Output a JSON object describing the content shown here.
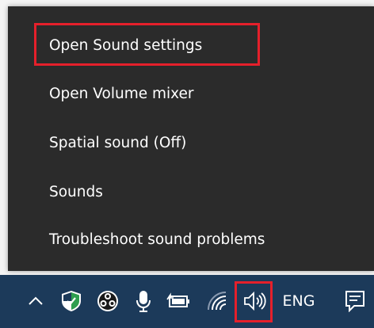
{
  "menu": {
    "items": [
      {
        "label": "Open Sound settings"
      },
      {
        "label": "Open Volume mixer"
      },
      {
        "label": "Spatial sound (Off)"
      },
      {
        "label": "Sounds"
      },
      {
        "label": "Troubleshoot sound problems"
      }
    ]
  },
  "taskbar": {
    "icons": {
      "chevron": "chevron-up-icon",
      "defender": "windows-security-icon",
      "obs": "obs-studio-icon",
      "mic": "microphone-icon",
      "battery": "battery-icon",
      "wifi": "wifi-icon",
      "speaker": "speaker-icon",
      "notifications": "notification-center-icon"
    },
    "language": "ENG"
  },
  "colors": {
    "menu_bg": "#2b2b2b",
    "taskbar_bg": "#1c3a5a",
    "highlight": "#e5202b",
    "defender_green": "#2e9e4f"
  }
}
